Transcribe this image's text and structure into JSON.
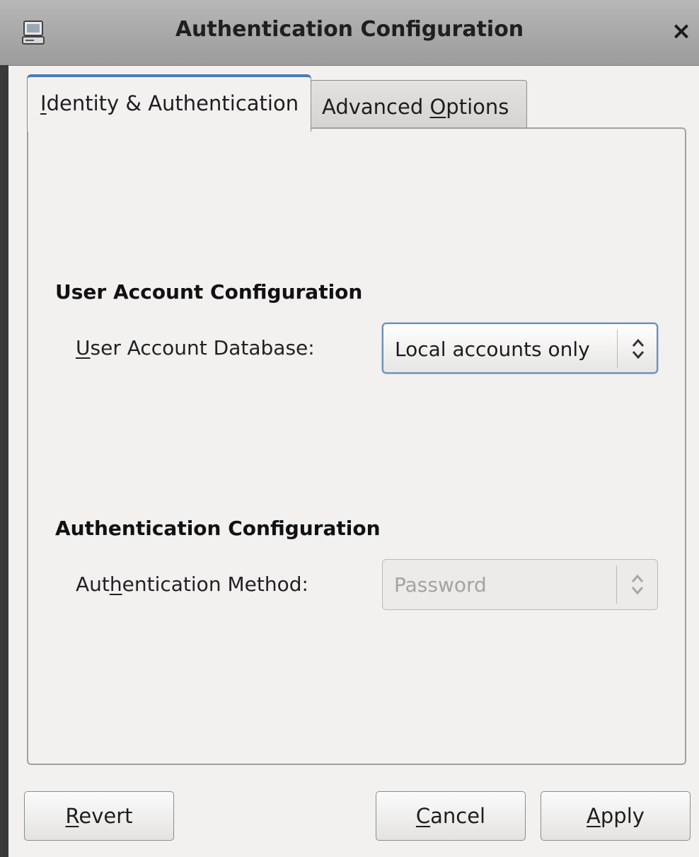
{
  "window": {
    "title": "Authentication Configuration",
    "close_glyph": "×",
    "icon": "computer-icon"
  },
  "tabs": [
    {
      "label_pre": "",
      "mnemonic": "I",
      "label_post": "dentity & Authentication",
      "active": true
    },
    {
      "label_pre": "Advanced ",
      "mnemonic": "O",
      "label_post": "ptions",
      "active": false
    }
  ],
  "user_account": {
    "section_title": "User Account Configuration",
    "label_pre": "",
    "label_mnemonic": "U",
    "label_post": "ser Account Database:",
    "value": "Local accounts only"
  },
  "authentication": {
    "section_title": "Authentication Configuration",
    "label_pre": "Aut",
    "label_mnemonic": "h",
    "label_post": "entication Method:",
    "value": "Password",
    "disabled": true
  },
  "buttons": {
    "revert": {
      "pre": "",
      "mnemonic": "R",
      "post": "evert"
    },
    "cancel": {
      "pre": "",
      "mnemonic": "C",
      "post": "ancel"
    },
    "apply": {
      "pre": "",
      "mnemonic": "A",
      "post": "pply"
    }
  },
  "colors": {
    "titlebar": "#a9a9a9",
    "active_tab_accent": "#4a7bb3",
    "background": "#f2f1f0"
  }
}
